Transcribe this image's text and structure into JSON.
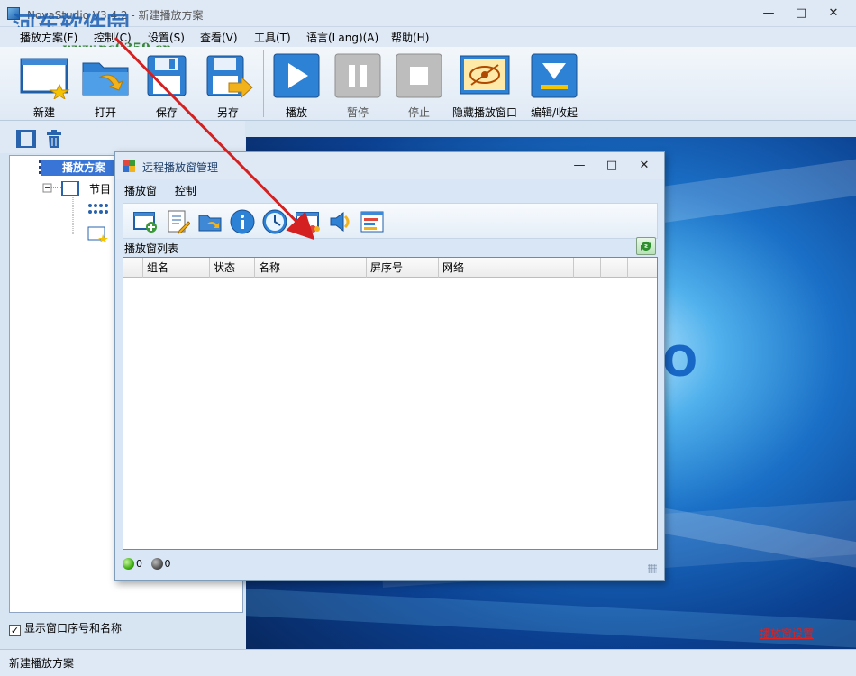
{
  "app": {
    "title": "NovaStudio V3.4.2 - 新建播放方案",
    "watermark": "河东软件园",
    "watermark_url": "www.pc0359.cn"
  },
  "menu": [
    "播放方案(F)",
    "控制(C)",
    "设置(S)",
    "查看(V)",
    "工具(T)",
    "语言(Lang)(A)",
    "帮助(H)"
  ],
  "toolbar": {
    "new": "新建",
    "open": "打开",
    "save": "保存",
    "save_as": "另存",
    "play": "播放",
    "pause": "暂停",
    "stop": "停止",
    "hide_window": "隐藏播放窗口",
    "edit_collapse": "编辑/收起"
  },
  "tree": {
    "root": "播放方案",
    "node": "节目"
  },
  "show_index_checkbox": {
    "label": "显示窗口序号和名称",
    "checked": true
  },
  "preview": {
    "settings_link": "播放窗设置",
    "letter": "O"
  },
  "status_bar": "新建播放方案",
  "dialog": {
    "title": "远程播放窗管理",
    "menu": [
      "播放窗",
      "控制"
    ],
    "list_caption": "播放窗列表",
    "columns": [
      "",
      "组名",
      "状态",
      "名称",
      "屏序号",
      "网络",
      "",
      "",
      ""
    ],
    "online_count": "0",
    "offline_count": "0"
  },
  "colors": {
    "accent": "#3875d6",
    "annotation_arrow": "#d42020"
  }
}
